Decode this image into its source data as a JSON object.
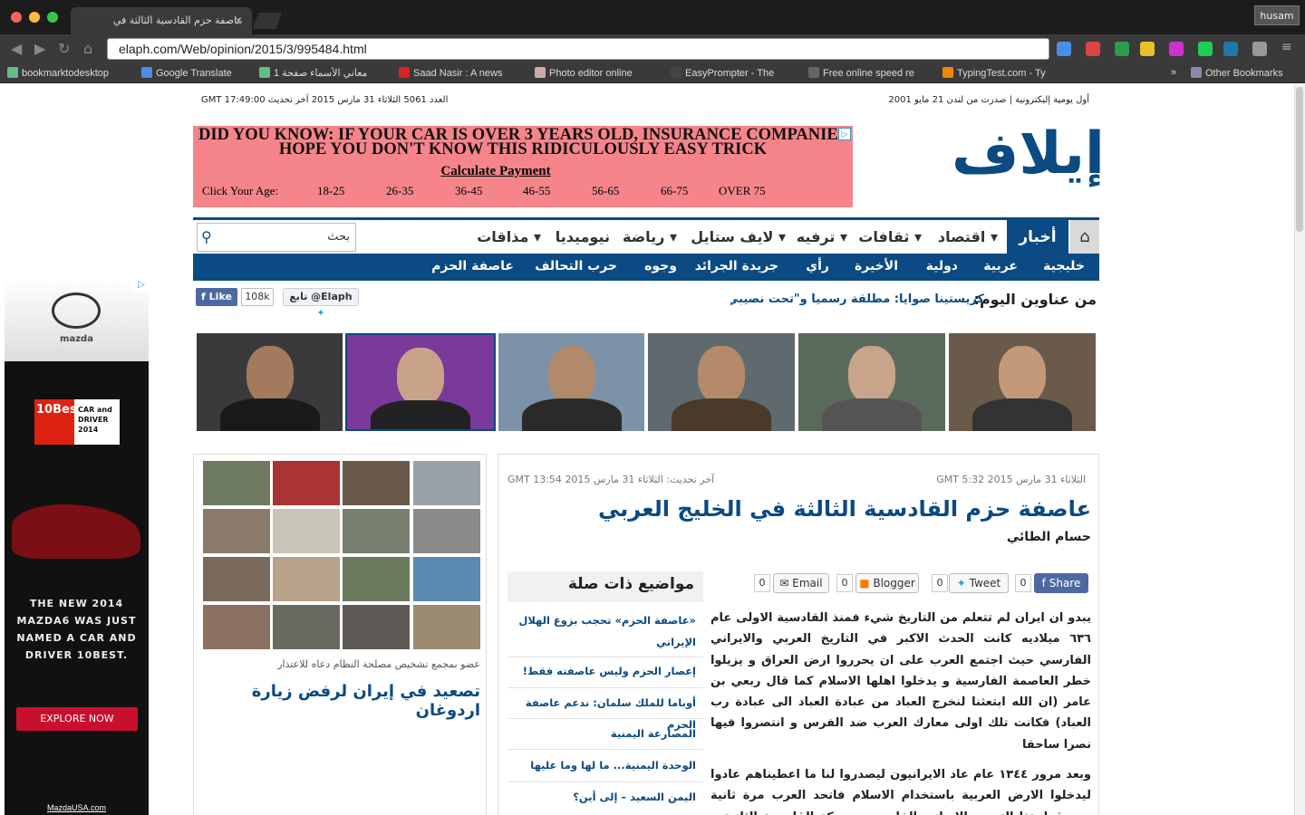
{
  "browser": {
    "tab_title": "عاصفة حزم القادسية الثالثة في",
    "tab_close": "×",
    "profile_name": "husam",
    "back_icon": "back-arrow",
    "forward_icon": "forward-arrow",
    "reload_icon": "reload",
    "home_icon": "home",
    "url": "elaph.com/Web/opinion/2015/3/995484.html",
    "bookmarks": [
      "bookmarktodesktop",
      "Google Translate",
      "معاني الأسماء صفحة 1",
      "Saad Nasir : A news",
      "Photo editor online",
      "EasyPrompter - The",
      "Free online speed re",
      "TypingTest.com - Ty"
    ],
    "bookmarks_overflow": "»",
    "other_bookmarks": "Other Bookmarks"
  },
  "header": {
    "tagline": "أول يومية إليكترونية | صدرت من لندن 21 مايو 2001",
    "issue": "العدد 5061 الثلاثاء 31 مارس 2015 آخر تحديث GMT 17:49:00",
    "logo": "إيلاف"
  },
  "ad_banner": {
    "headline": "DID YOU KNOW:  IF YOUR CAR IS OVER 3 YEARS OLD, INSURANCE COMPANIES HOPE YOU DON'T KNOW THIS RIDICULOUSLY EASY TRICK",
    "cta": "Calculate Payment",
    "age_label": "Click Your Age:",
    "ages": [
      "18-25",
      "26-35",
      "36-45",
      "46-55",
      "56-65",
      "66-75",
      "OVER 75"
    ],
    "adchoice": "▷"
  },
  "nav": {
    "home_icon": "⌂",
    "active": "أخبار",
    "items": [
      "اقتصاد",
      "ثقافات",
      "ترفيه",
      "لايف ستايل",
      "رياضة",
      "نيوميديا",
      "مذاقات"
    ],
    "search_placeholder": "بحث",
    "search_icon": "⚲"
  },
  "subnav": {
    "items": [
      "خليجية",
      "عربية",
      "دولية",
      "الأخيرة",
      "رأي",
      "جريدة الجرائد",
      "وجوه",
      "حرب التحالف",
      "عاصفة الحزم"
    ]
  },
  "social": {
    "fb_like": "Like",
    "fb_count": "108k",
    "tw_follow": "تابع @Elaph"
  },
  "headlines": {
    "label": "من عناوين اليوم:",
    "text": "كريستينا صوايا: مطلقة رسمياً و\"تحت نصيبي\" مع"
  },
  "gallery": {
    "caption": "عضو بمجمع تشخيص مصلحة النظام دعاه للاعتذار",
    "title": "تصعيد في إيران لرفض زيارة اردوغان"
  },
  "article": {
    "published": "الثلاثاء 31 مارس 2015 GMT 5:32",
    "updated": "آخر تحديث: الثلاثاء 31 مارس 2015 GMT 13:54",
    "title": "عاصفة حزم القادسية الثالثة في الخليج العربي",
    "author": "حسام الطائي",
    "share": {
      "share_label": "Share",
      "share_count": "0",
      "tweet_label": "Tweet",
      "tweet_count": "0",
      "blogger_label": "Blogger",
      "blogger_count": "0",
      "email_label": "Email",
      "email_count": "0"
    },
    "body_p1": "يبدو ان ايران لم تتعلم من التاريخ شيء فمنذ القادسية الاولى عام ٦٣٦ ميلاديه كانت الحدث الاكبر في التاريخ العربي والايراني الفارسي حيث اجتمع العرب على ان يحرروا ارض العراق و يزيلوا خطر العاصمة الفارسية و يدخلوا اهلها الاسلام كما قال ربعي بن عامر (ان الله ابتعثنا لنخرج العباد من عبادة العباد الى عبادة رب العباد) فكانت تلك اولى معارك العرب ضد الفرس و انتصروا فيها نصرا ساحقا",
    "body_p2": "وبعد مرور ١٣٤٤ عام عاد الايرانيون ليصدروا لنا ما اعطيناهم عادوا ليدخلوا الارض العربية باستخدام الاسلام فاتحد العرب مرة ثانية وسحقوا هذا التوسع الايراني الفارسي بمعركة القادسية الثانية و بعد \"تجرع كأس السم\" و سلسلة"
  },
  "related": {
    "title": "مواضيع ذات صلة",
    "items": [
      "«عاصفة الحزم» تحجب بزوغ الهلال الإيراني",
      "إعصار الحزم وليس عاصفته فقط!",
      "أوباما للملك سلمان: ندعم عاصفة الحزم",
      "المصارعة اليمنية",
      "الوحدة اليمنية... ما لها وما عليها",
      "اليمن السعيد – إلى أين؟"
    ]
  },
  "left_ad": {
    "brand": "mazda",
    "award": "10Best",
    "award_sub": "CAR and DRIVER 2014",
    "copy": "THE NEW 2014 MAZDA6 WAS JUST NAMED A CAR AND DRIVER 10BEST.",
    "cta": "EXPLORE NOW",
    "url": "MazdaUSA.com"
  }
}
